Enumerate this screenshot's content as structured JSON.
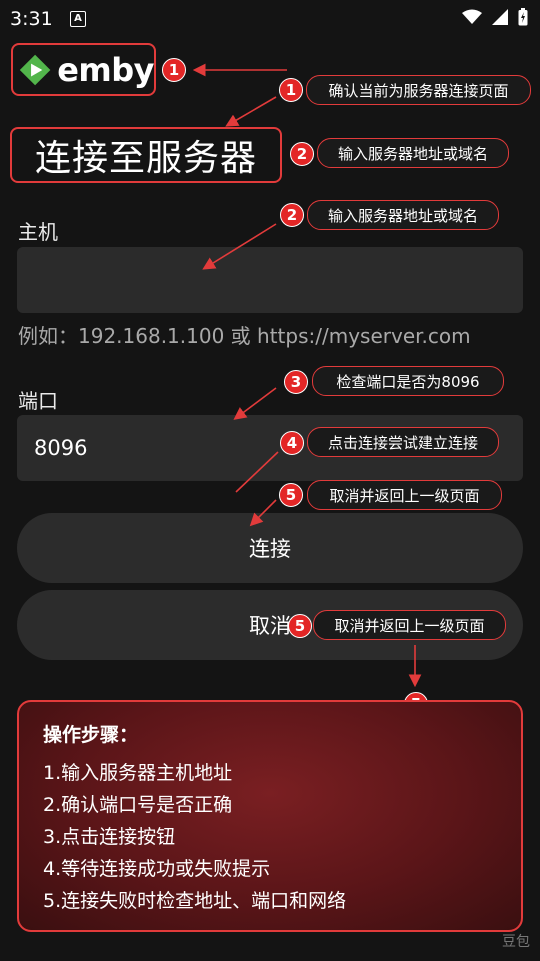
{
  "status_bar": {
    "time": "3:31",
    "app_badge": "A"
  },
  "logo": {
    "text": "emby"
  },
  "page_title": "连接至服务器",
  "host": {
    "label": "主机",
    "value": "",
    "hint": "例如：192.168.1.100 或 https://myserver.com"
  },
  "port": {
    "label": "端口",
    "value": "8096"
  },
  "buttons": {
    "connect": "连接",
    "cancel": "取消"
  },
  "callouts": [
    {
      "number": "1",
      "text": "确认当前为服务器连接页面"
    },
    {
      "number": "2",
      "text": "输入服务器地址或域名"
    },
    {
      "number": "2",
      "text": "输入服务器地址或域名"
    },
    {
      "number": "3",
      "text": "检查端口是否为8096"
    },
    {
      "number": "4",
      "text": "点击连接尝试建立连接"
    },
    {
      "number": "5",
      "text": "取消并返回上一级页面"
    },
    {
      "number": "5",
      "text": "取消并返回上一级页面"
    }
  ],
  "badges": {
    "logo": "1",
    "steps": "5"
  },
  "steps": {
    "title": "操作步骤：",
    "items": [
      "1.输入服务器主机地址",
      "2.确认端口号是否正确",
      "3.点击连接按钮",
      "4.等待连接成功或失败提示",
      "5.连接失败时检查地址、端口和网络"
    ]
  },
  "watermark": "豆包",
  "colors": {
    "accent": "#e23b3b",
    "field_bg": "#2b2b2b",
    "emby_green": "#52b54b"
  }
}
